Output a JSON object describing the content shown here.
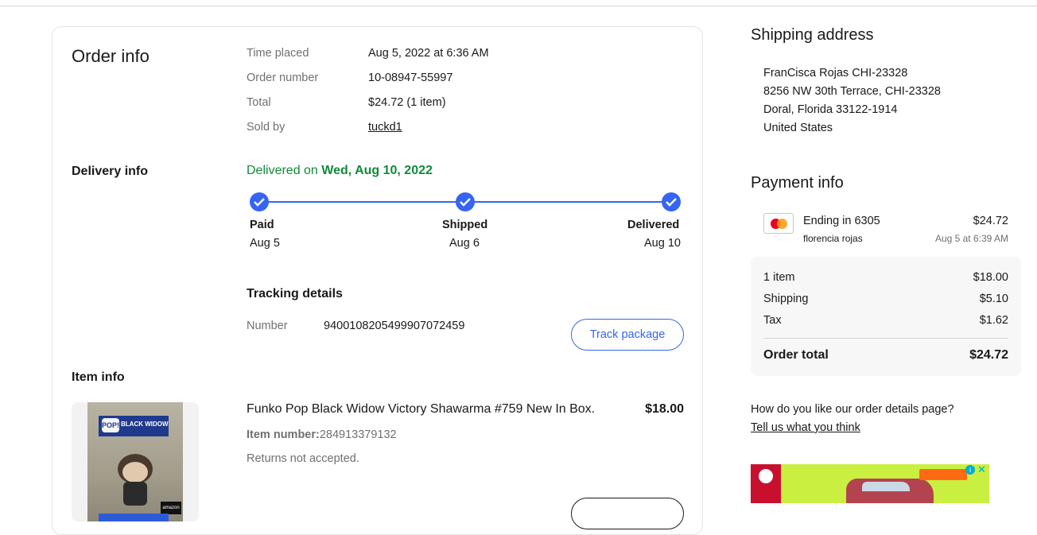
{
  "order_info": {
    "title": "Order info",
    "rows": [
      {
        "label": "Time placed",
        "value": "Aug 5, 2022 at 6:36 AM"
      },
      {
        "label": "Order number",
        "value": "10-08947-55997"
      },
      {
        "label": "Total",
        "value": "$24.72 (1 item)"
      },
      {
        "label": "Sold by",
        "value": "tuckd1"
      }
    ]
  },
  "delivery_info": {
    "title": "Delivery info",
    "status_prefix": "Delivered on",
    "status_date": "Wed, Aug 10, 2022",
    "steps": [
      {
        "label": "Paid",
        "date": "Aug 5"
      },
      {
        "label": "Shipped",
        "date": "Aug 6"
      },
      {
        "label": "Delivered",
        "date": "Aug 10"
      }
    ],
    "tracking_title": "Tracking details",
    "tracking_number_label": "Number",
    "tracking_number": "9400108205499907072459",
    "track_button": "Track package"
  },
  "item_info": {
    "title": "Item info",
    "item_name": "Funko Pop Black Widow Victory Shawarma #759 New In Box.",
    "price": "$18.00",
    "item_number_label": "Item number:",
    "item_number": "284913379132",
    "returns": "Returns not accepted.",
    "image_text": {
      "brand": "POP!",
      "box_name": "BLACK WIDOW",
      "retailer": "amazon"
    }
  },
  "shipping_address": {
    "title": "Shipping address",
    "lines": [
      "FranCisca Rojas CHI-23328",
      "8256 NW 30th Terrace, CHI-23328",
      "Doral, Florida 33122-1914",
      "United States"
    ]
  },
  "payment_info": {
    "title": "Payment info",
    "card_icon": "mastercard-icon",
    "card_ending": "Ending in 6305",
    "card_name": "florencia rojas",
    "amount": "$24.72",
    "date": "Aug 5 at 6:39 AM",
    "summary": [
      {
        "label": "1 item",
        "value": "$18.00"
      },
      {
        "label": "Shipping",
        "value": "$5.10"
      },
      {
        "label": "Tax",
        "value": "$1.62"
      }
    ],
    "total_label": "Order total",
    "total_value": "$24.72"
  },
  "feedback": {
    "question": "How do you like our order details page?",
    "link": "Tell us what you think"
  },
  "colors": {
    "accent": "#3665f3",
    "delivered_green": "#118a3b",
    "muted_text": "#707070"
  }
}
